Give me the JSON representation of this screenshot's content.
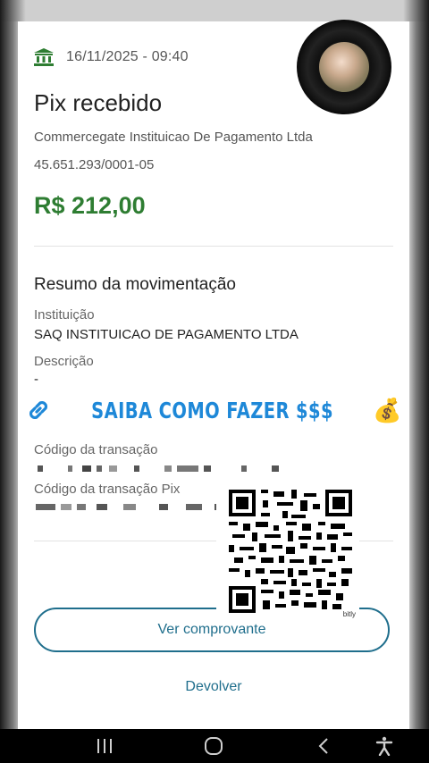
{
  "header": {
    "date": "16/11/2025 - 09:40"
  },
  "transaction": {
    "title": "Pix recebido",
    "company": "Commercegate Instituicao De Pagamento Ltda",
    "cnpj": "45.651.293/0001-05",
    "amount": "R$ 212,00"
  },
  "summary": {
    "title": "Resumo da movimentação",
    "institution_label": "Instituição",
    "institution_value": "SAQ INSTITUICAO DE PAGAMENTO LTDA",
    "description_label": "Descrição",
    "description_value": "-",
    "tx_code_label": "Código da transação",
    "pix_code_label": "Código da transação Pix"
  },
  "promo": {
    "text": "SAIBA COMO FAZER $$$",
    "link_icon": "link-icon",
    "emoji": "💰"
  },
  "qr": {
    "brand": "bitly"
  },
  "actions": {
    "view_receipt": "Ver comprovante",
    "refund": "Devolver"
  },
  "colors": {
    "amount_green": "#2e7d32",
    "action_blue": "#1f6e8c",
    "promo_blue": "#1e88d8"
  },
  "navbar": {
    "recents_icon": "recents-icon",
    "home_icon": "home-icon",
    "back_icon": "back-icon",
    "accessibility_icon": "accessibility-icon"
  }
}
